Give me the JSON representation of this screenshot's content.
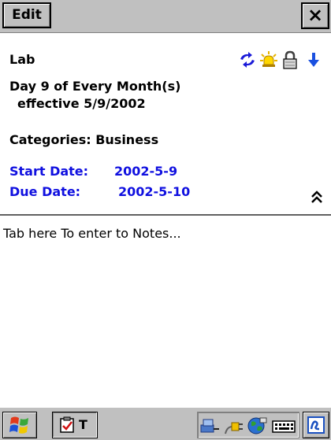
{
  "toolbar": {
    "edit_label": "Edit",
    "close_label": "×"
  },
  "task": {
    "title": "Lab",
    "recurrence": "Day 9 of Every Month(s)",
    "effective": "effective 5/9/2002",
    "categories": "Categories: Business",
    "start_label": "Start Date:",
    "start_value": "2002-5-9",
    "due_label": "Due Date:",
    "due_value": "2002-5-10",
    "status_icons": [
      "recurrence-icon",
      "reminder-icon",
      "private-lock-icon",
      "low-priority-icon"
    ],
    "collapse_icon": "collapse-up-icon"
  },
  "notes": {
    "prompt": "Tab here To enter to Notes..."
  },
  "taskbar": {
    "start_icon": "windows-flag-icon",
    "task_button_icon": "tasks-checkbox-icon",
    "task_button_label": "T",
    "tray_icons": [
      "connectivity-icon",
      "power-plug-icon",
      "globe-network-icon",
      "keyboard-icon"
    ],
    "corner_icon": "input-panel-icon"
  },
  "colors": {
    "chrome": "#c0c0c0",
    "date_blue": "#1010e0",
    "text": "#000000"
  }
}
